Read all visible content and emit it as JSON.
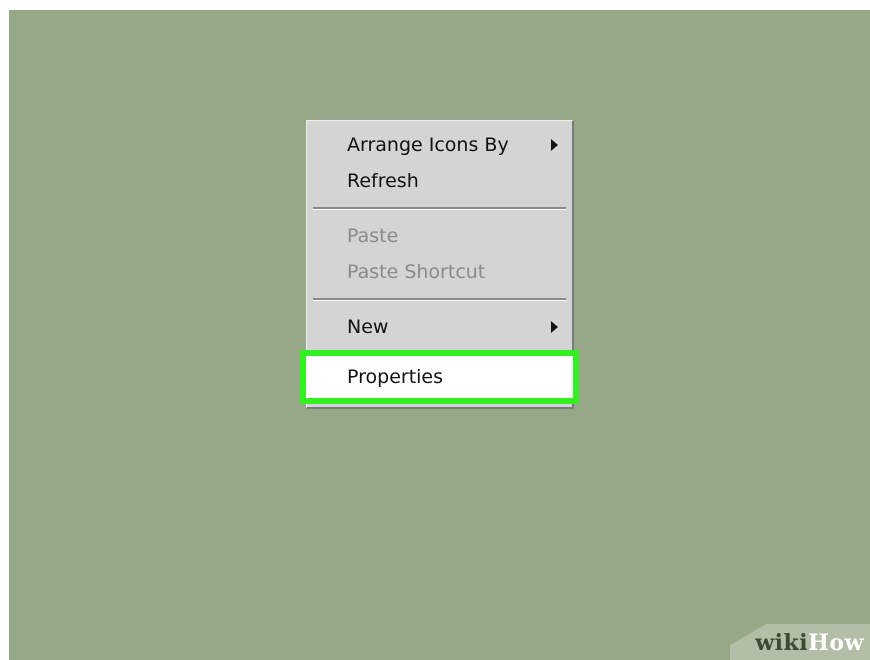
{
  "context_menu": {
    "items": [
      {
        "label": "Arrange Icons By",
        "has_submenu": true,
        "enabled": true
      },
      {
        "label": "Refresh",
        "has_submenu": false,
        "enabled": true
      },
      {
        "label": "Paste",
        "has_submenu": false,
        "enabled": false
      },
      {
        "label": "Paste Shortcut",
        "has_submenu": false,
        "enabled": false
      },
      {
        "label": "New",
        "has_submenu": true,
        "enabled": true
      },
      {
        "label": "Properties",
        "has_submenu": false,
        "enabled": true,
        "highlighted": true
      }
    ]
  },
  "watermark": {
    "part1": "wiki",
    "part2": "How"
  },
  "colors": {
    "desktop_background": "#97a886",
    "menu_background": "#d4d4d4",
    "highlight_border": "#33ee22"
  }
}
